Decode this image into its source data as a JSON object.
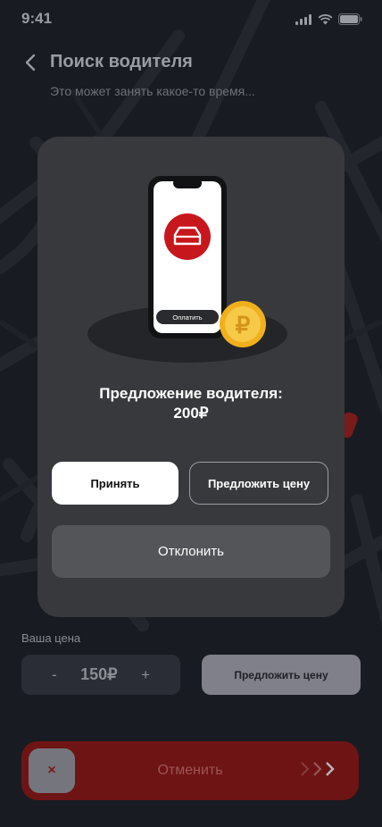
{
  "status_bar": {
    "time": "9:41"
  },
  "header": {
    "title": "Поиск водителя",
    "subtitle": "Это может занять какое-то время..."
  },
  "modal": {
    "phone_pay_label": "Оплатить",
    "coin_symbol": "₽",
    "offer_title": "Предложение водителя:",
    "offer_price": "200₽",
    "accept_label": "Принять",
    "suggest_label": "Предложить цену",
    "decline_label": "Отклонить"
  },
  "price": {
    "label": "Ваша цена",
    "minus": "-",
    "value": "150₽",
    "plus": "+",
    "suggest_label": "Предложить цену"
  },
  "cancel": {
    "label": "Отменить",
    "knob_symbol": "×"
  },
  "colors": {
    "brand_red": "#c8161d",
    "modal_bg": "#38393d",
    "coin_gold": "#f0b01c"
  }
}
